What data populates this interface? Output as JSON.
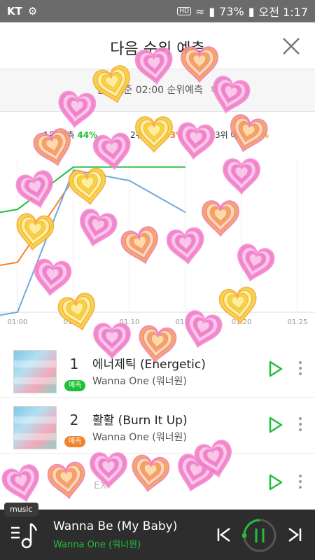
{
  "status_bar": {
    "carrier": "KT",
    "battery": "73%",
    "time": "오전 1:17",
    "hd": "HD"
  },
  "header": {
    "title": "다음 순위 예측"
  },
  "sub_bar": {
    "text": "현재기준 02:00 순위예측"
  },
  "predictions": [
    {
      "rank_label": "1위 예측",
      "percent": "44%",
      "color": "#1fbf3a"
    },
    {
      "rank_label": "2위 예측",
      "percent": "33%",
      "color": "#f2832c"
    },
    {
      "rank_label": "3위 예측",
      "percent": "23%",
      "color": "#d8c21a"
    }
  ],
  "chart_data": {
    "type": "line",
    "x": [
      "01:00",
      "01:05",
      "01:10",
      "01:15",
      "01:20",
      "01:25"
    ],
    "series": [
      {
        "name": "1위",
        "color": "#1fbf3a",
        "points": [
          [
            0,
            0.68
          ],
          [
            1,
            0.96
          ],
          [
            3,
            0.96
          ]
        ]
      },
      {
        "name": "2위",
        "color": "#f2832c",
        "points": [
          [
            0,
            0.33
          ],
          [
            1,
            0.88
          ]
        ]
      },
      {
        "name": "3위",
        "color": "#6fa8dc",
        "points": [
          [
            0,
            0.0
          ],
          [
            1,
            0.94
          ],
          [
            2,
            0.87
          ],
          [
            3,
            0.66
          ]
        ]
      }
    ],
    "grid": true
  },
  "songs": [
    {
      "rank": "1",
      "badge": "예측",
      "badge_color": "#1fbf3a",
      "title": "에너제틱 (Energetic)",
      "artist": "Wanna One (워너원)"
    },
    {
      "rank": "2",
      "badge": "예측",
      "badge_color": "#f2832c",
      "title": "활활 (Burn It Up)",
      "artist": "Wanna One (워너원)"
    },
    {
      "rank": "3",
      "badge": "",
      "badge_color": "#d8c21a",
      "title": "",
      "artist": "EX"
    }
  ],
  "player": {
    "tab_label": "music",
    "title": "Wanna Be (My Baby)",
    "artist": "Wanna One (워너원)",
    "accent": "#1fbf3a"
  }
}
